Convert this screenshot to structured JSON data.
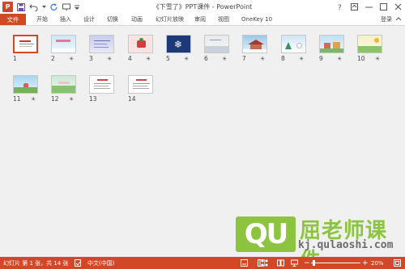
{
  "window": {
    "title": "《下雪了》PPT课件 - PowerPoint",
    "app_logo": "P",
    "app_icon": "powerpoint-icon",
    "accent_color": "#d24726"
  },
  "qat": {
    "icons": [
      "save-icon",
      "undo-icon",
      "redo-icon",
      "repeat-icon",
      "customize-qat-icon"
    ]
  },
  "ribbon": {
    "file_label": "文件",
    "tabs": [
      "开始",
      "插入",
      "设计",
      "切换",
      "动画",
      "幻灯片放映",
      "审阅",
      "视图",
      "OneKey 10"
    ],
    "signin_label": "登录"
  },
  "slides": [
    {
      "number": "1",
      "star": "",
      "selected": true,
      "theme": "cover"
    },
    {
      "number": "2",
      "star": "☀",
      "theme": "sky"
    },
    {
      "number": "3",
      "star": "☀",
      "theme": "lilac"
    },
    {
      "number": "4",
      "star": "☀",
      "theme": "pink"
    },
    {
      "number": "5",
      "star": "☀",
      "theme": "navy"
    },
    {
      "number": "6",
      "star": "☀",
      "theme": "mist"
    },
    {
      "number": "7",
      "star": "☀",
      "theme": "house"
    },
    {
      "number": "8",
      "star": "☀",
      "theme": "snow"
    },
    {
      "number": "9",
      "star": "☀",
      "theme": "village"
    },
    {
      "number": "10",
      "star": "☀",
      "theme": "field"
    },
    {
      "number": "11",
      "star": "☀",
      "theme": "sunny"
    },
    {
      "number": "12",
      "star": "☀",
      "theme": "garden"
    },
    {
      "number": "13",
      "star": "",
      "theme": "plain"
    },
    {
      "number": "14",
      "star": "",
      "theme": "plain"
    }
  ],
  "watermark": {
    "logo_text": "QU",
    "brand": "屈老师课件",
    "url": "kj.qulaoshi.com"
  },
  "statusbar": {
    "slide_info": "幻灯片 第 1 张，共 14 张",
    "language": "中文(中国)",
    "zoom_minus": "−",
    "zoom_plus": "+",
    "zoom_value": "20%",
    "zoom_level": 0.2,
    "view_icons": [
      "normal-view-icon",
      "slide-sorter-view-icon",
      "reading-view-icon",
      "slideshow-view-icon"
    ]
  }
}
